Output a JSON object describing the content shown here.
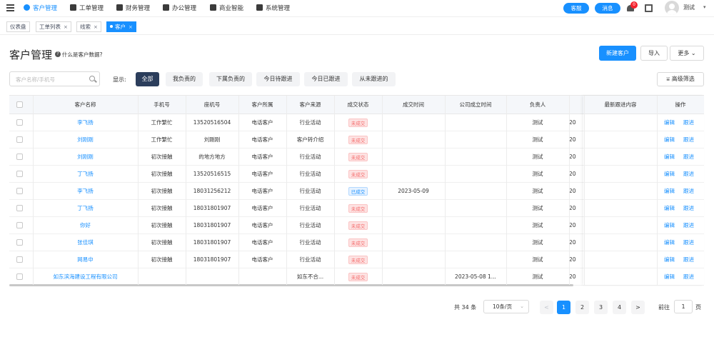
{
  "topnav": {
    "items": [
      {
        "label": "客户管理",
        "icon": "user-icon",
        "active": true
      },
      {
        "label": "工单管理",
        "icon": "clipboard-icon",
        "active": false
      },
      {
        "label": "财务管理",
        "icon": "wallet-icon",
        "active": false
      },
      {
        "label": "办公管理",
        "icon": "printer-icon",
        "active": false
      },
      {
        "label": "商业智能",
        "icon": "chart-icon",
        "active": false
      },
      {
        "label": "系统管理",
        "icon": "wrench-icon",
        "active": false
      }
    ],
    "btn_a": "客服",
    "btn_b": "消息",
    "notification_count": "0",
    "username": "测试"
  },
  "tags": [
    {
      "label": "仪表盘",
      "closable": false,
      "active": false
    },
    {
      "label": "工单列表",
      "closable": true,
      "active": false
    },
    {
      "label": "线索",
      "closable": true,
      "active": false
    },
    {
      "label": "客户",
      "closable": true,
      "active": true
    }
  ],
  "page": {
    "title": "客户管理",
    "help_text": "什么是客户数据?",
    "new_button": "新建客户",
    "import_button": "导入",
    "more_button": "更多"
  },
  "filters": {
    "search_placeholder": "客户名称/手机号",
    "show_label": "显示:",
    "chips": [
      "全部",
      "我负责的",
      "下属负责的",
      "今日待跟进",
      "今日已跟进",
      "从未跟进的"
    ],
    "active_chip": 0,
    "advanced_button": "高级筛选"
  },
  "table": {
    "columns": [
      "",
      "客户名称",
      "手机号",
      "座机号",
      "客户所属",
      "客户来源",
      "成交状态",
      "成交时间",
      "公司成立时间",
      "负责人",
      "",
      "最新跟进内容",
      "操作"
    ],
    "actions": [
      "编辑",
      "跟进"
    ],
    "rows": [
      {
        "name": "李飞扬",
        "mobile": "工作繁忙",
        "phone": "13520516504",
        "belong": "电话客户",
        "source": "行业活动",
        "status": "未成交",
        "deal_time": "",
        "founded": "",
        "owner": "测试",
        "extra": "20"
      },
      {
        "name": "刘刚刚",
        "mobile": "工作繁忙",
        "phone": "刘刚刚",
        "belong": "电话客户",
        "source": "客户转介绍",
        "status": "未成交",
        "deal_time": "",
        "founded": "",
        "owner": "测试",
        "extra": "20"
      },
      {
        "name": "刘刚刚",
        "mobile": "初次接触",
        "phone": "的地方地方",
        "belong": "电话客户",
        "source": "行业活动",
        "status": "未成交",
        "deal_time": "",
        "founded": "",
        "owner": "测试",
        "extra": "20"
      },
      {
        "name": "丁飞扬",
        "mobile": "初次接触",
        "phone": "13520516515",
        "belong": "电话客户",
        "source": "行业活动",
        "status": "未成交",
        "deal_time": "",
        "founded": "",
        "owner": "测试",
        "extra": "20"
      },
      {
        "name": "李飞扬",
        "mobile": "初次接触",
        "phone": "18031256212",
        "belong": "电话客户",
        "source": "行业活动",
        "status": "已成交",
        "deal_time": "2023-05-09",
        "founded": "",
        "owner": "测试",
        "extra": "20"
      },
      {
        "name": "丁飞扬",
        "mobile": "初次接触",
        "phone": "18031801907",
        "belong": "电话客户",
        "source": "行业活动",
        "status": "未成交",
        "deal_time": "",
        "founded": "",
        "owner": "测试",
        "extra": "20"
      },
      {
        "name": "你好",
        "mobile": "初次接触",
        "phone": "18031801907",
        "belong": "电话客户",
        "source": "行业活动",
        "status": "未成交",
        "deal_time": "",
        "founded": "",
        "owner": "测试",
        "extra": "20"
      },
      {
        "name": "张佳琪",
        "mobile": "初次接触",
        "phone": "18031801907",
        "belong": "电话客户",
        "source": "行业活动",
        "status": "未成交",
        "deal_time": "",
        "founded": "",
        "owner": "测试",
        "extra": "20"
      },
      {
        "name": "网易中",
        "mobile": "初次接触",
        "phone": "18031801907",
        "belong": "电话客户",
        "source": "行业活动",
        "status": "未成交",
        "deal_time": "",
        "founded": "",
        "owner": "测试",
        "extra": "20"
      },
      {
        "name": "如东滨海建设工程有限公司",
        "mobile": "",
        "phone": "",
        "belong": "",
        "source": "如东不合...",
        "status": "未成交",
        "deal_time": "",
        "founded": "2023-05-08 1...",
        "owner": "测试",
        "extra": "20"
      }
    ]
  },
  "pagination": {
    "total": "共 34 条",
    "page_size": "10条/页",
    "prev": "<",
    "pages": [
      "1",
      "2",
      "3",
      "4"
    ],
    "current": "1",
    "next": ">",
    "goto_label": "前往",
    "goto_value": "1",
    "goto_suffix": "页"
  },
  "colors": {
    "primary": "#1890ff",
    "danger": "#f56c6c",
    "chip_active": "#2c3e5c"
  }
}
